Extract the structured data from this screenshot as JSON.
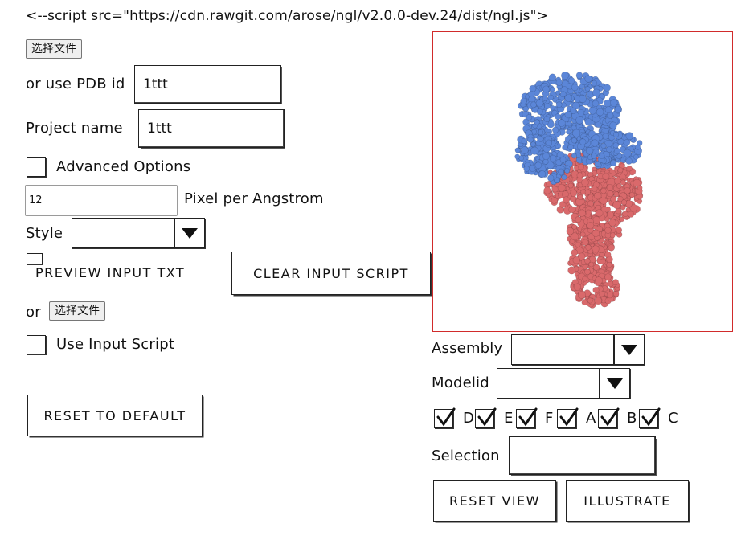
{
  "header_text": "<--script src=\"https://cdn.rawgit.com/arose/ngl/v2.0.0-dev.24/dist/ngl.js\">",
  "file_button_label": "选择文件",
  "pdb": {
    "label": "or use PDB id",
    "value": "1ttt"
  },
  "project": {
    "label": "Project name",
    "value": "1ttt"
  },
  "advanced": {
    "label": "Advanced Options",
    "checked": false
  },
  "pixel": {
    "value": "12",
    "label": "Pixel per Angstrom"
  },
  "style": {
    "label": "Style",
    "value": ""
  },
  "preview_label": "PREVIEW INPUT TXT",
  "clear_button": "CLEAR INPUT SCRIPT",
  "or_label": "or",
  "file_button2_label": "选择文件",
  "use_script": {
    "label": "Use Input Script",
    "checked": false
  },
  "reset_default_button": "RESET TO DEFAULT",
  "assembly": {
    "label": "Assembly",
    "value": ""
  },
  "modelid": {
    "label": "Modelid",
    "value": ""
  },
  "chains": [
    {
      "label": "D",
      "checked": true
    },
    {
      "label": "E",
      "checked": true
    },
    {
      "label": "F",
      "checked": true
    },
    {
      "label": "A",
      "checked": true
    },
    {
      "label": "B",
      "checked": true
    },
    {
      "label": "C",
      "checked": true
    }
  ],
  "selection": {
    "label": "Selection",
    "value": ""
  },
  "reset_view_button": "RESET VIEW",
  "illustrate_button": "ILLUSTRATE",
  "colors": {
    "blue_chain": "#5b86d8",
    "red_chain": "#d9696b",
    "viewer_border": "#d12b2b"
  }
}
